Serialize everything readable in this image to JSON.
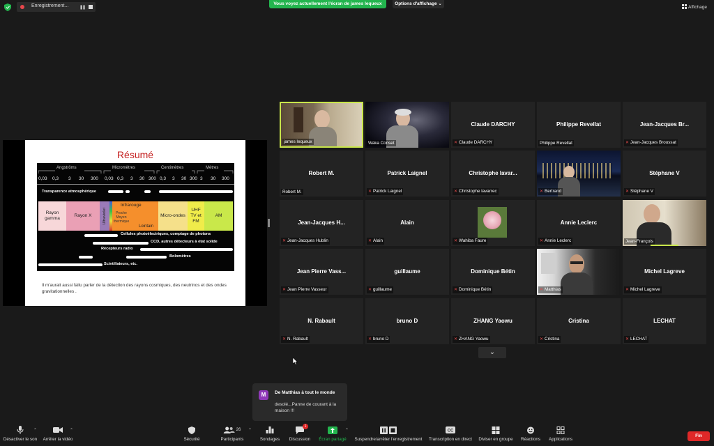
{
  "top": {
    "recording_label": "Enregistrement...",
    "share_banner": "Vous voyez actuellement l'écran de james lequeux",
    "view_options": "Options d'affichage",
    "view_label": "Affichage"
  },
  "slide": {
    "title": "Résumé",
    "categories": [
      "Angströms",
      "Micromètres",
      "Centimètres",
      "Mètres"
    ],
    "ticks": [
      "0,03",
      "0,3",
      "3",
      "30",
      "300",
      "0,03",
      "0,3",
      "3",
      "30",
      "300",
      "0,3",
      "3",
      "30",
      "300",
      "3",
      "30",
      "300"
    ],
    "transparency": "Transparence atmosphérique",
    "bands": {
      "gamma": "Rayon gamma",
      "x": "Rayon X",
      "uv": "Ultraviolet",
      "ir": "Infrarouge",
      "ir_near": "Proche Moyen thermique",
      "ir_far": "Lointain",
      "micro": "Micro-ondes",
      "uhf": "UHF TV et FM",
      "am": "AM"
    },
    "detectors": {
      "photo": "Cellules photoélectriques, comptage de photons",
      "ccd": "CCD, autres détecteurs à état solide",
      "radio": "Récepteurs radio",
      "bolo": "Bolomètres",
      "scint": "Scintillateurs, etc."
    },
    "note": "Il m'aurait aussi fallu parler de la détection des rayons cosmiques, des neutrinos et des ondes gravitationnelles ."
  },
  "tiles": [
    {
      "center": "",
      "label": "james lequeux",
      "muted": false,
      "video": "speaker"
    },
    {
      "center": "",
      "label": "Waka Conset",
      "muted": false,
      "video": "galaxy"
    },
    {
      "center": "Claude DARCHY",
      "label": "Claude DARCHY",
      "muted": true,
      "video": ""
    },
    {
      "center": "Philippe Revellat",
      "label": "Philippe Revellat",
      "muted": false,
      "video": ""
    },
    {
      "center": "Jean-Jacques  Br...",
      "label": "Jean-Jacques Broussat",
      "muted": true,
      "video": ""
    },
    {
      "center": "Robert M.",
      "label": "Robert M.",
      "muted": false,
      "video": ""
    },
    {
      "center": "Patrick Laignel",
      "label": "Patrick Laignel",
      "muted": true,
      "video": ""
    },
    {
      "center": "Christophe  lavar...",
      "label": "Christophe lavarrec",
      "muted": true,
      "video": ""
    },
    {
      "center": "",
      "label": "Bertrand",
      "muted": true,
      "video": "city"
    },
    {
      "center": "Stéphane V",
      "label": "Stéphane V",
      "muted": true,
      "video": ""
    },
    {
      "center": "Jean-Jacques  H...",
      "label": "Jean-Jacques Hublin",
      "muted": true,
      "video": ""
    },
    {
      "center": "Alain",
      "label": "Alain",
      "muted": true,
      "video": ""
    },
    {
      "center": "",
      "label": "Wahiba Faure",
      "muted": true,
      "video": "flower"
    },
    {
      "center": "Annie Leclerc",
      "label": "Annie Leclerc",
      "muted": true,
      "video": ""
    },
    {
      "center": "",
      "label": "Jean-François",
      "muted": false,
      "video": "person"
    },
    {
      "center": "Jean Pierre Vass...",
      "label": "Jean Pierre Vasseur",
      "muted": true,
      "video": ""
    },
    {
      "center": "guillaume",
      "label": "guillaume",
      "muted": true,
      "video": ""
    },
    {
      "center": "Dominique Bétin",
      "label": "Dominique Bétin",
      "muted": true,
      "video": ""
    },
    {
      "center": "",
      "label": "Matthias",
      "muted": true,
      "video": "person2"
    },
    {
      "center": "Michel Lagreve",
      "label": "Michel Lagreve",
      "muted": true,
      "video": ""
    },
    {
      "center": "N. Rabault",
      "label": "N. Rabault",
      "muted": true,
      "video": ""
    },
    {
      "center": "bruno D",
      "label": "bruno D",
      "muted": true,
      "video": ""
    },
    {
      "center": "ZHANG Yaowu",
      "label": "ZHANG Yaowu",
      "muted": true,
      "video": ""
    },
    {
      "center": "Cristina",
      "label": "Cristina",
      "muted": true,
      "video": ""
    },
    {
      "center": "LECHAT",
      "label": "LECHAT",
      "muted": true,
      "video": ""
    }
  ],
  "chat": {
    "avatar": "M",
    "from": "De Matthias à tout le monde",
    "message": "desolé...Panne de courant à la maison !!!"
  },
  "toolbar": {
    "mute": "Désactiver le son",
    "video": "Arrêter la vidéo",
    "security": "Sécurité",
    "participants": "Participants",
    "participants_count": "26",
    "polls": "Sondages",
    "chat": "Discussion",
    "chat_badge": "1",
    "share": "Écran partagé",
    "record": "Suspendre/arrêter l'enregistrement",
    "transcript": "Transcription en direct",
    "rooms": "Diviser en groupe",
    "reactions": "Réactions",
    "apps": "Applications",
    "end": "Fin"
  },
  "colors": {
    "share_green": "#23b54e",
    "end_red": "#e02828",
    "speaker_border": "#c9e64b",
    "tile_bg": "#232323"
  }
}
